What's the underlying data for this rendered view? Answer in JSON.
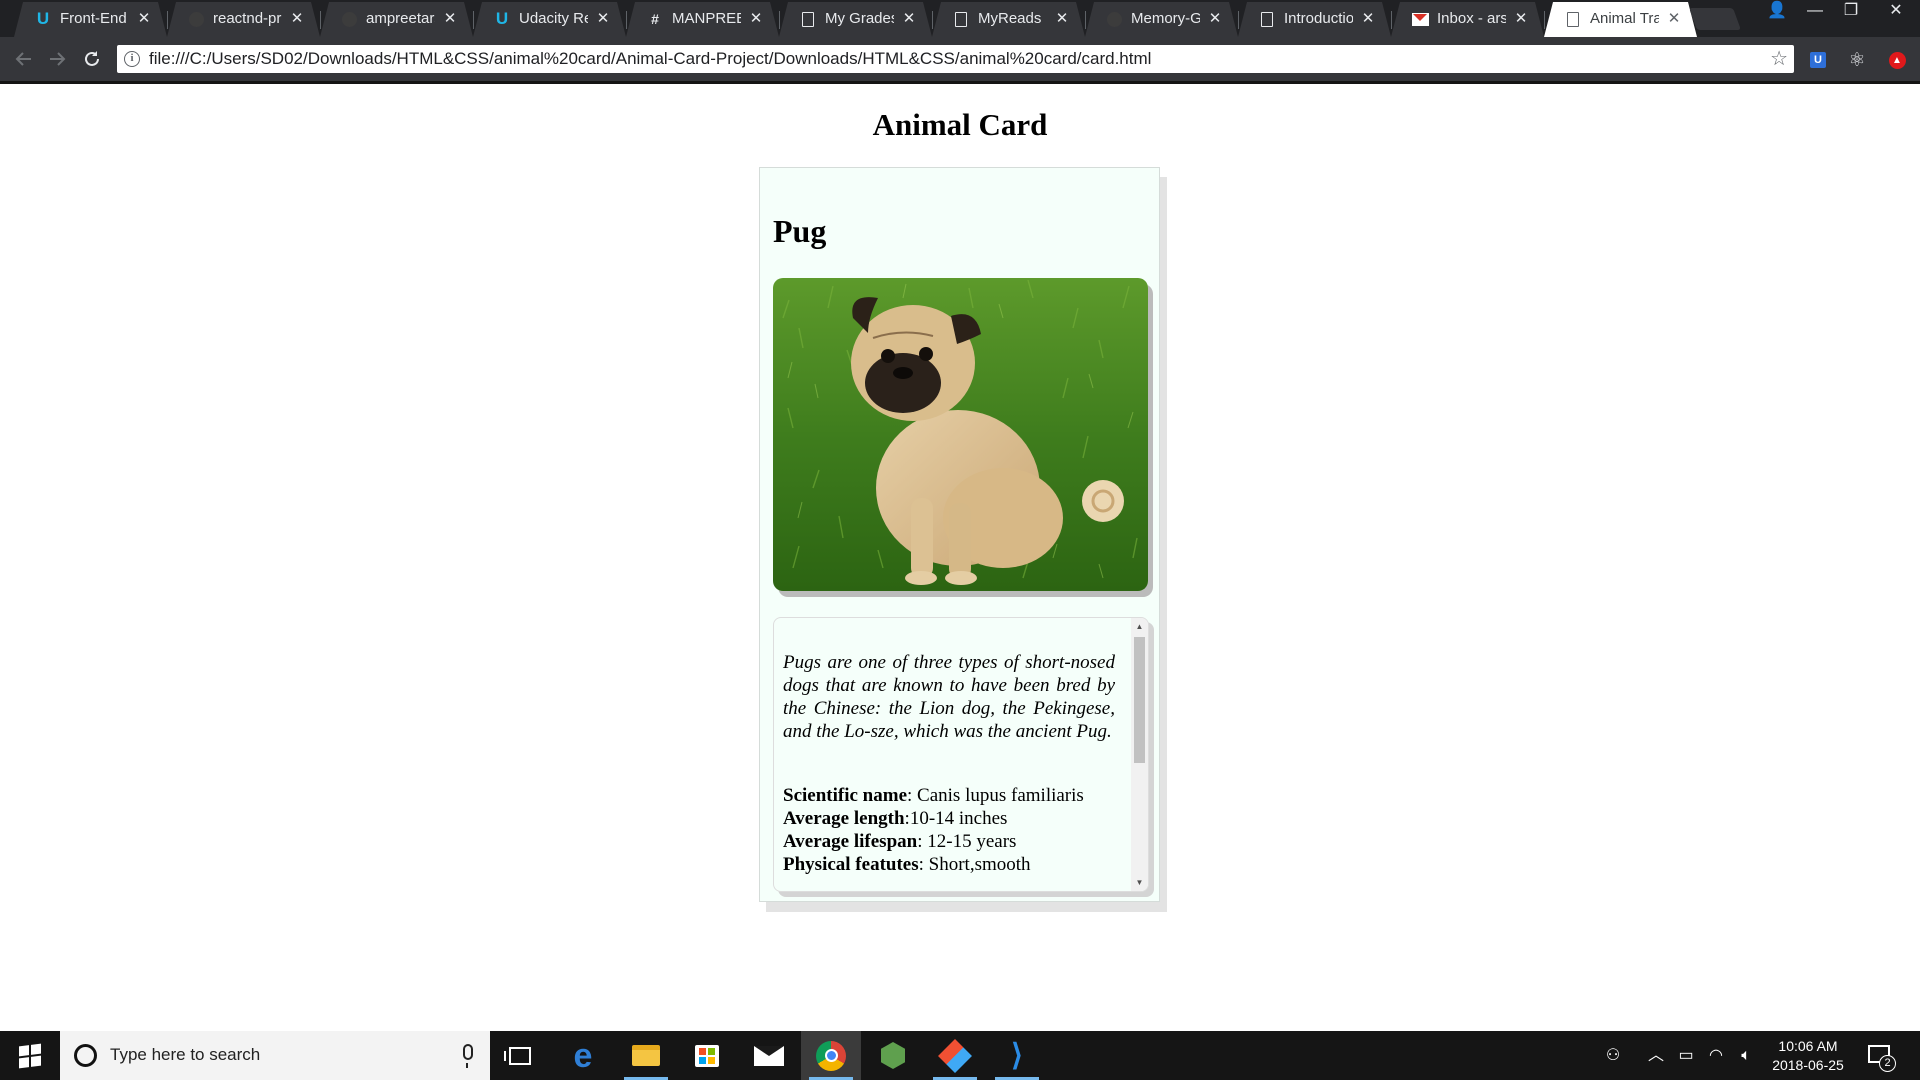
{
  "browser": {
    "tabs": [
      {
        "title": "Front-End W",
        "favicon": "udacity-icon",
        "active": false
      },
      {
        "title": "reactnd-pro",
        "favicon": "github-icon",
        "active": false
      },
      {
        "title": "ampreetarsl",
        "favicon": "github-icon",
        "active": false
      },
      {
        "title": "Udacity Rev",
        "favicon": "udacity-icon",
        "active": false
      },
      {
        "title": "MANPREET",
        "favicon": "slack-icon",
        "active": false
      },
      {
        "title": "My Grades",
        "favicon": "document-icon",
        "active": false
      },
      {
        "title": "MyReads",
        "favicon": "document-icon",
        "active": false
      },
      {
        "title": "Memory-Ga",
        "favicon": "github-icon",
        "active": false
      },
      {
        "title": "Introductio",
        "favicon": "document-icon",
        "active": false
      },
      {
        "title": "Inbox - arsh",
        "favicon": "gmail-icon",
        "active": false
      },
      {
        "title": "Animal Trad",
        "favicon": "document-icon",
        "active": true
      }
    ],
    "tab_close_glyph": "✕",
    "url": "file:///C:/Users/SD02/Downloads/HTML&CSS/animal%20card/Animal-Card-Project/Downloads/HTML&CSS/animal%20card/card.html",
    "window_controls": {
      "profile": "👤",
      "minimize": "—",
      "restore": "❐",
      "close": "✕"
    },
    "extensions": [
      "udacity-extension-icon",
      "react-devtools-icon",
      "red-extension-icon"
    ],
    "ext_udacity_label": "U",
    "ext_react_glyph": "⚛",
    "ext_red_glyph": "▲"
  },
  "page": {
    "title": "Animal Card",
    "card": {
      "name": "Pug",
      "description": "Pugs are one of three types of short-nosed dogs that are known to have been bred by the Chinese: the Lion dog, the Pekingese, and the Lo-sze, which was the ancient Pug.",
      "facts": [
        {
          "label": "Scientific name",
          "separator": ": ",
          "value": "Canis lupus familiaris"
        },
        {
          "label": "Average length",
          "separator": ":",
          "value": "10-14 inches"
        },
        {
          "label": "Average lifespan",
          "separator": ": ",
          "value": "12-15 years"
        },
        {
          "label": "Physical featutes",
          "separator": ": ",
          "value": "Short,smooth"
        }
      ]
    }
  },
  "taskbar": {
    "search_placeholder": "Type here to search",
    "apps": [
      "task-view-icon",
      "edge-icon",
      "file-explorer-icon",
      "store-icon",
      "mail-icon",
      "chrome-icon",
      "node-icon",
      "gitkraken-icon",
      "vscode-icon"
    ],
    "clock_time": "10:06 AM",
    "clock_date": "2018-06-25",
    "notification_count": "2"
  },
  "colors": {
    "chrome_frame": "#202124",
    "toolbar": "#35363a",
    "card_background": "#f5fffa",
    "taskbar": "#151515"
  }
}
